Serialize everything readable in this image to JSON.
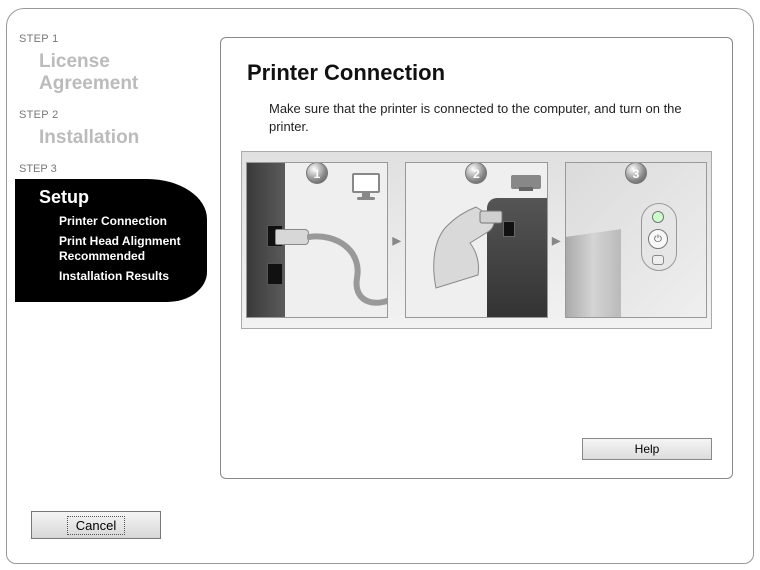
{
  "sidebar": {
    "step1": {
      "label": "STEP 1",
      "title": "License Agreement"
    },
    "step2": {
      "label": "STEP 2",
      "title": "Installation"
    },
    "step3": {
      "label": "STEP 3",
      "title": "Setup",
      "items": [
        "Printer Connection",
        "Print Head Alignment Recommended",
        "Installation Results"
      ]
    }
  },
  "content": {
    "heading": "Printer Connection",
    "instruction": "Make sure that the printer is connected to the computer, and turn on the printer.",
    "badges": [
      "1",
      "2",
      "3"
    ],
    "power_glyph": "⏻"
  },
  "buttons": {
    "help": "Help",
    "cancel": "Cancel"
  },
  "icons": {
    "arrow": "▸"
  }
}
